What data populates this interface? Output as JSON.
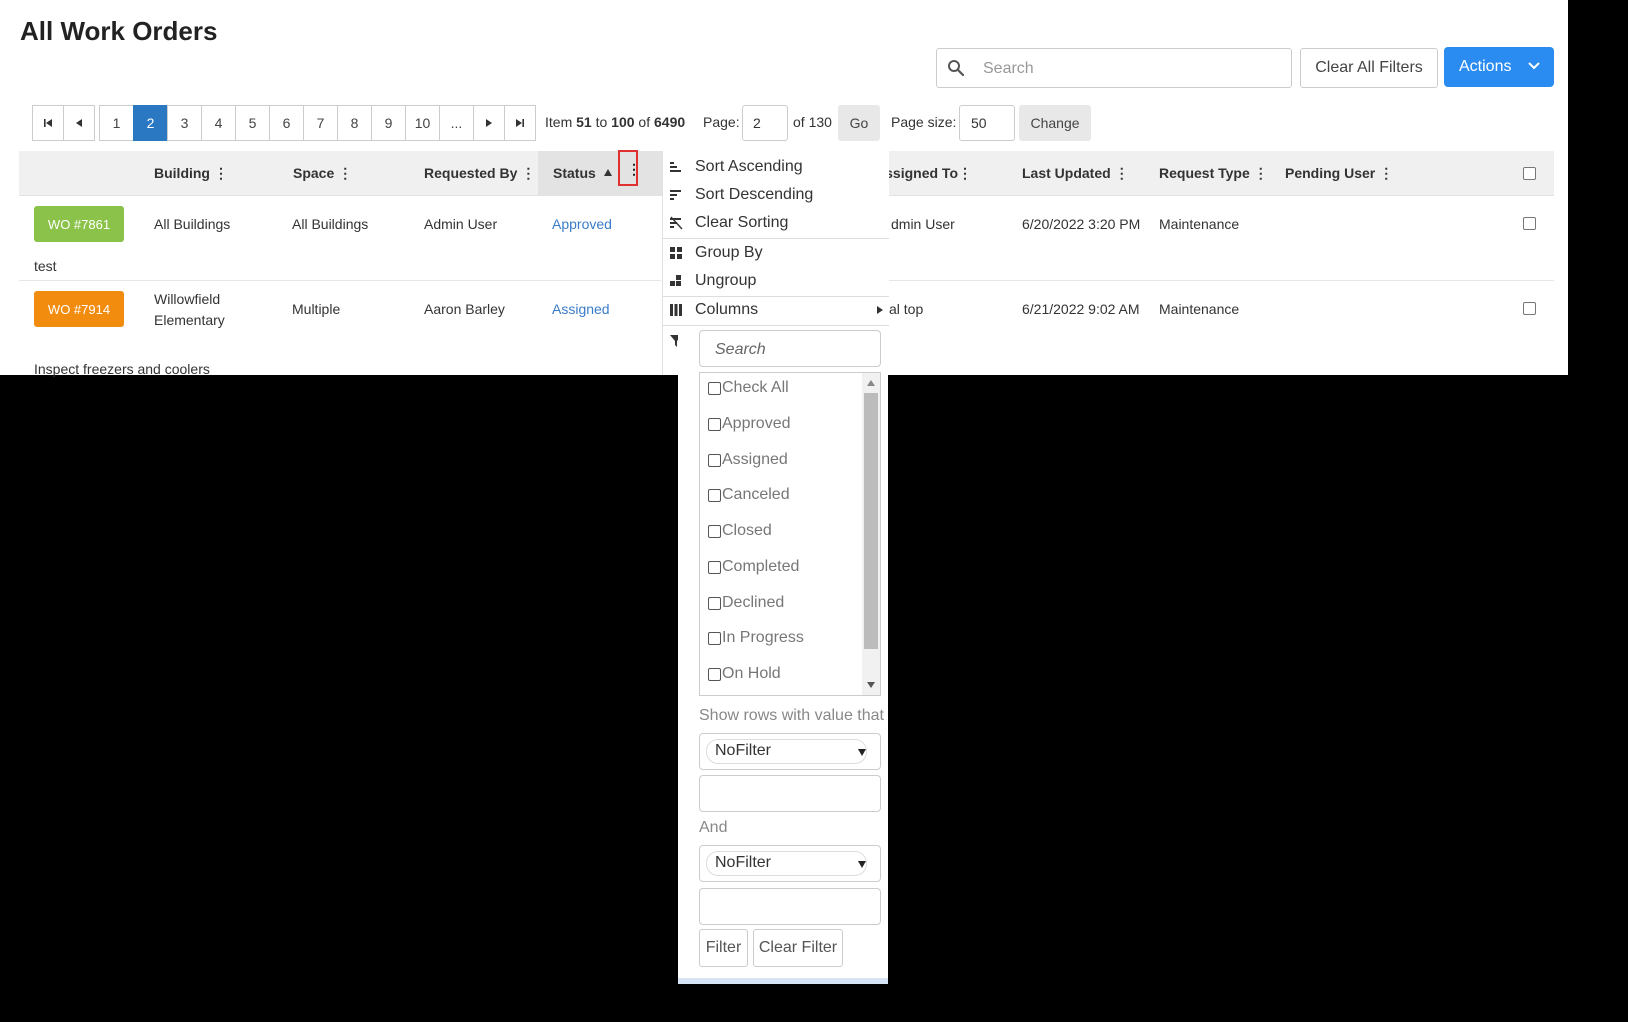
{
  "page": {
    "title": "All Work Orders"
  },
  "toolbar": {
    "search_placeholder": "Search",
    "clear_all_filters_label": "Clear All Filters",
    "actions_label": "Actions"
  },
  "pager": {
    "pages": [
      "1",
      "2",
      "3",
      "4",
      "5",
      "6",
      "7",
      "8",
      "9",
      "10",
      "..."
    ],
    "active_page": "2",
    "item_prefix": "Item",
    "item_from": "51",
    "item_to_word": "to",
    "item_to": "100",
    "item_of_word": "of",
    "item_total": "6490",
    "page_label": "Page:",
    "page_value": "2",
    "page_of": "of 130",
    "go_label": "Go",
    "page_size_label": "Page size:",
    "page_size_value": "50",
    "change_label": "Change"
  },
  "grid": {
    "columns": {
      "building": "Building",
      "space": "Space",
      "requested_by": "Requested By",
      "status": "Status",
      "assigned_to": "Assigned To",
      "last_updated": "Last Updated",
      "request_type": "Request Type",
      "pending_user": "Pending User"
    },
    "sorted_column": "Status",
    "sort_direction": "ascending",
    "rows": [
      {
        "wo": "WO #7861",
        "wo_color": "#8bc34a",
        "building": "All Buildings",
        "space": "All Buildings",
        "requested_by": "Admin User",
        "status": "Approved",
        "assigned_to": "dmin User",
        "last_updated": "6/20/2022 3:20 PM",
        "request_type": "Maintenance",
        "description": "test"
      },
      {
        "wo": "WO #7914",
        "wo_color": "#f28c0f",
        "building_line1": "Willowfield",
        "building_line2": "Elementary",
        "space": "Multiple",
        "requested_by": "Aaron Barley",
        "status": "Assigned",
        "assigned_to": "al top",
        "last_updated": "6/21/2022 9:02 AM",
        "request_type": "Maintenance",
        "description": "Inspect freezers and coolers"
      }
    ]
  },
  "column_menu": {
    "sort_ascending": "Sort Ascending",
    "sort_descending": "Sort Descending",
    "clear_sorting": "Clear Sorting",
    "group_by": "Group By",
    "ungroup": "Ungroup",
    "columns": "Columns"
  },
  "filter": {
    "search_placeholder": "Search",
    "options": [
      "Check All",
      "Approved",
      "Assigned",
      "Canceled",
      "Closed",
      "Completed",
      "Declined",
      "In Progress",
      "On Hold"
    ],
    "show_rows_label": "Show rows with value that",
    "operator1": "NoFilter",
    "logic_label": "And",
    "operator2": "NoFilter",
    "filter_button": "Filter",
    "clear_filter_button": "Clear Filter"
  },
  "colors": {
    "primary": "#2a8cf0",
    "active_page": "#2a78c2",
    "status_link": "#3a7cc7",
    "highlight_box": "#e03131"
  }
}
